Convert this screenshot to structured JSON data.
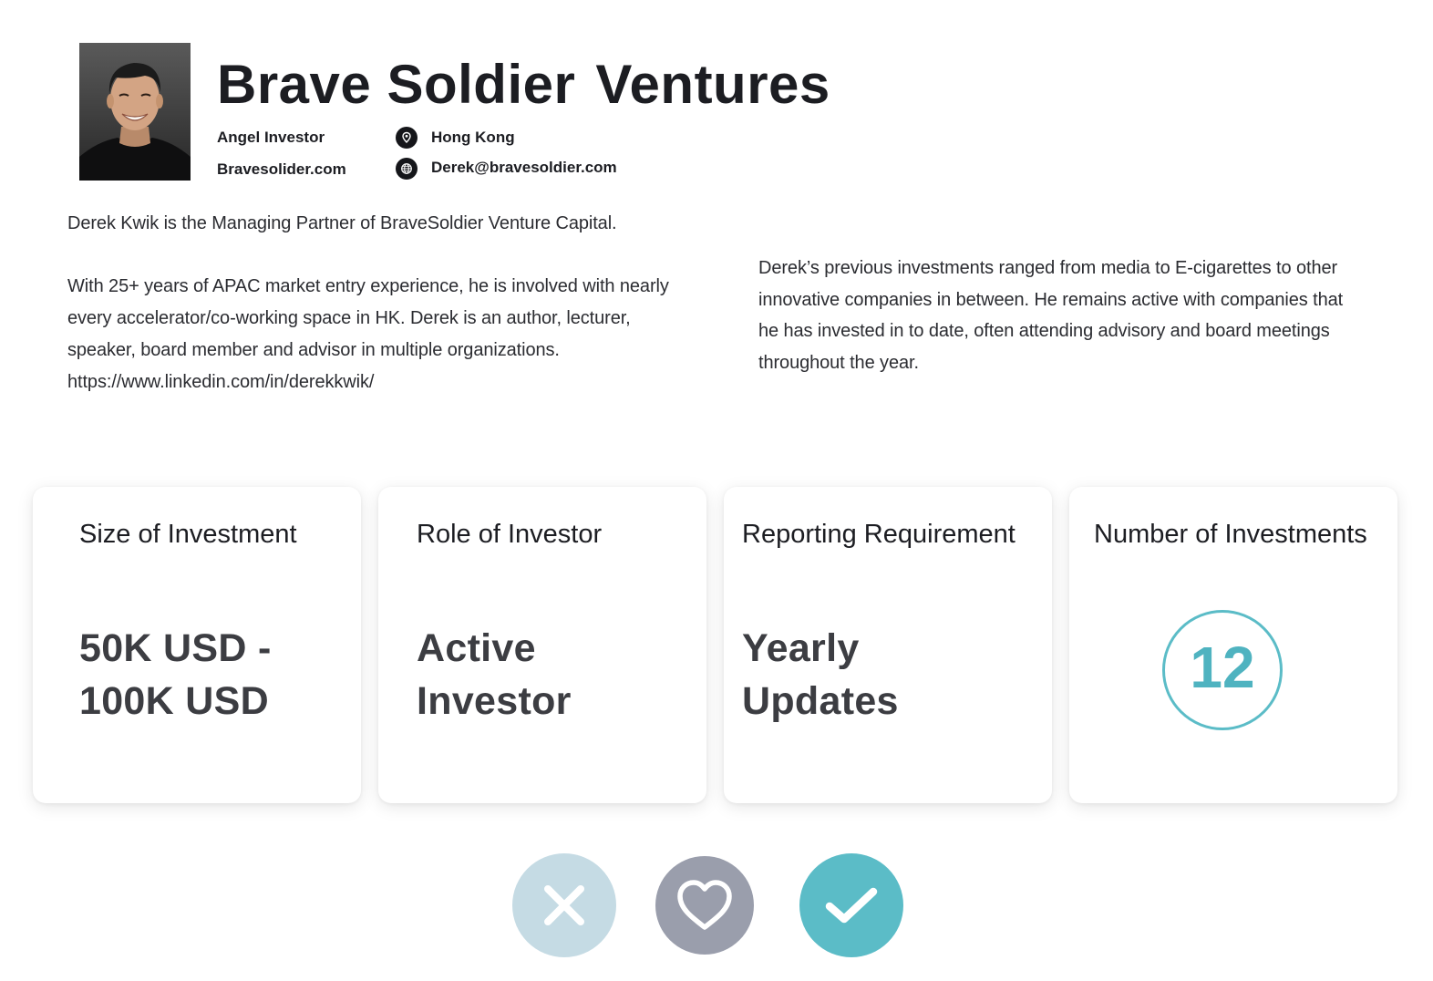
{
  "profile": {
    "title_part1": "Brave Soldier",
    "title_part2": "Ventures",
    "investor_type": "Angel Investor",
    "website": "Bravesolider.com",
    "location": "Hong Kong",
    "email": "Derek@bravesoldier.com"
  },
  "bio": {
    "paragraph1": "Derek Kwik is the Managing Partner of BraveSoldier Venture Capital.",
    "paragraph2_lines": [
      "With 25+ years of APAC market entry experience, he is involved with nearly",
      "every accelerator/co-working space in HK. Derek is an author, lecturer,",
      "speaker, board member and advisor in multiple organizations.",
      "https://www.linkedin.com/in/derekkwik/"
    ],
    "paragraph3_lines": [
      "Derek’s previous investments ranged from media to E-cigarettes to other",
      "innovative companies in between. He remains active with companies that",
      "he has invested in to date, often attending advisory and board meetings",
      "throughout the year."
    ]
  },
  "cards": [
    {
      "label": "Size of Investment",
      "value_line1": "50K USD -",
      "value_line2": "100K USD"
    },
    {
      "label": "Role of Investor",
      "value_line1": "Active",
      "value_line2": "Investor"
    },
    {
      "label": "Reporting Requirement",
      "value_line1": "Yearly",
      "value_line2": "Updates"
    },
    {
      "label": "Number of Investments",
      "count": "12"
    }
  ],
  "actions": {
    "reject_icon": "close-icon",
    "favorite_icon": "heart-icon",
    "accept_icon": "checkmark-icon"
  },
  "colors": {
    "accent": "#5bbcc7",
    "reject": "#c5dbe4",
    "favorite": "#9a9eac",
    "accept": "#5bbcc7",
    "text": "#1c1d22"
  }
}
